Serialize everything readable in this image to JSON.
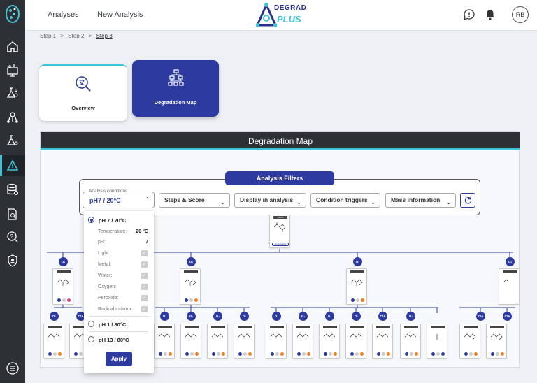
{
  "app": {
    "brand_line1": "DEGRAD",
    "brand_line2": "PLUS",
    "avatar_initials": "RB"
  },
  "topnav": [
    {
      "label": "Analyses"
    },
    {
      "label": "New Analysis"
    }
  ],
  "sidebar": {
    "items": [
      {
        "icon": "home-icon"
      },
      {
        "icon": "monitor-molecule-icon"
      },
      {
        "icon": "flask-molecule-icon"
      },
      {
        "icon": "molecule-network-icon"
      },
      {
        "icon": "flask-icon"
      },
      {
        "icon": "degradation-triangle-icon",
        "active": true
      },
      {
        "icon": "database-icon"
      },
      {
        "icon": "report-search-icon"
      },
      {
        "icon": "question-search-icon"
      },
      {
        "icon": "shield-user-icon"
      },
      {
        "icon": "menu-icon"
      }
    ]
  },
  "breadcrumb": {
    "steps": [
      "Step 1",
      "Step 2",
      "Step 3"
    ],
    "separator": ">"
  },
  "cards": {
    "overview": "Overview",
    "degradation_map": "Degradation Map"
  },
  "panel": {
    "title": "Degradation Map"
  },
  "filters": {
    "title": "Analysis Filters",
    "conditions_legend": "Analysis conditions",
    "conditions_value": "pH7 / 20°C",
    "dropdowns": [
      "Steps & Score",
      "Display in analysis",
      "Condition triggers",
      "Mass information"
    ]
  },
  "conditions_menu": {
    "options": [
      {
        "label": "pH 7 / 20°C",
        "selected": true
      },
      {
        "label": "pH 1 / 80°C",
        "selected": false
      },
      {
        "label": "pH 13 / 80°C",
        "selected": false
      }
    ],
    "params": [
      {
        "name": "Temperature:",
        "value": "20 °C"
      },
      {
        "name": "pH:",
        "value": "7"
      }
    ],
    "checks": [
      "Light:",
      "Metal:",
      "Water:",
      "Oxygen:",
      "Peroxide:",
      "Radical initiator:"
    ],
    "apply_label": "Apply"
  },
  "tree": {
    "parent_label": "Parent",
    "parent_badge": "All degradants",
    "level1": [
      {
        "trigger": "O₂"
      },
      {
        "trigger": "O₂"
      },
      {
        "trigger": "O₂"
      },
      {
        "trigger": "O₂"
      }
    ],
    "level2_triggers": [
      "O₂",
      "C/A",
      "O₂",
      "O₂",
      "O₂",
      "O₂",
      "O₂",
      "O₂",
      "O₂",
      "O₂",
      "C/A",
      "O₂",
      "C/A",
      "C/A"
    ]
  },
  "colors": {
    "primary": "#2d3aa0",
    "accent": "#3fc4d7",
    "sidebar": "#2d3035",
    "icon_orange": "#f47c20",
    "icon_pink": "#e0437a"
  }
}
